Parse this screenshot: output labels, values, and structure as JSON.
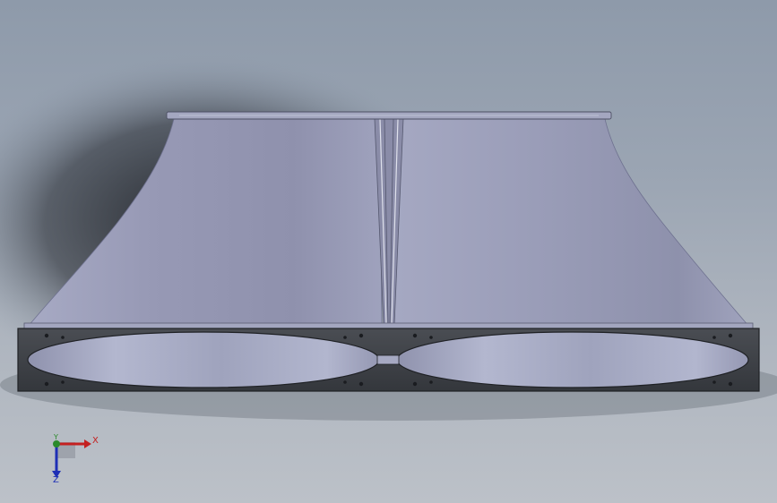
{
  "viewport": {
    "background_top": "#8e9aaa",
    "background_bottom": "#bcc1c8"
  },
  "model": {
    "body_color": "#9a9db8",
    "frame_color": "#3c3f44",
    "bore_color": "#a9adc6"
  },
  "triad": {
    "x_label": "X",
    "y_label": "Y",
    "z_label": "Z",
    "x_color": "#c42020",
    "y_color": "#2a8a2a",
    "z_color": "#1e2fb5"
  }
}
